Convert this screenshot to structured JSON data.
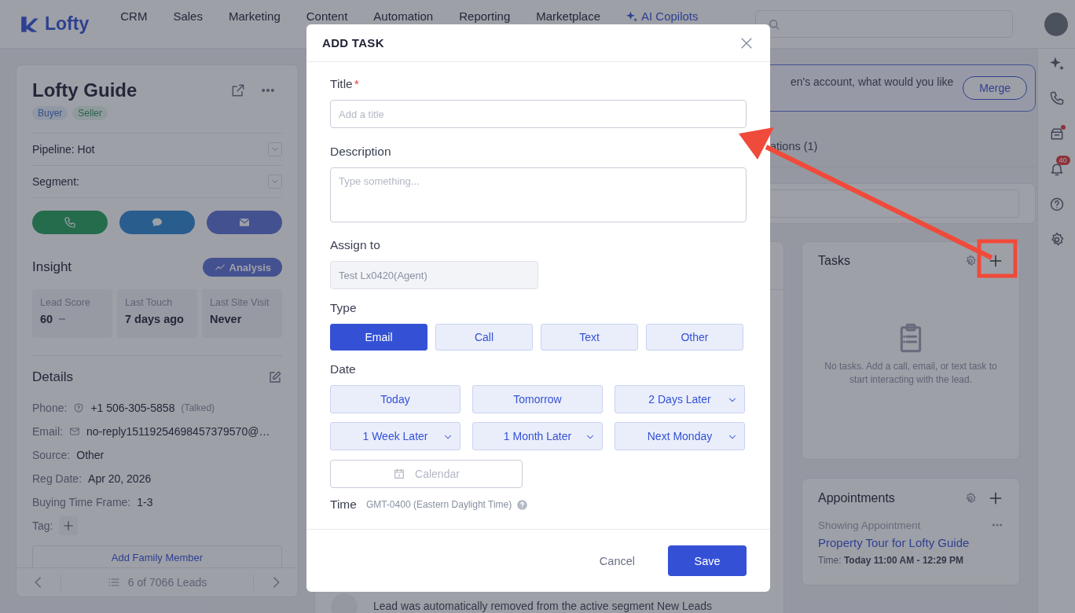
{
  "topbar": {
    "logo": "Lofty",
    "nav": [
      {
        "label": "CRM",
        "kind": "plain"
      },
      {
        "label": "Sales",
        "kind": "plain"
      },
      {
        "label": "Marketing",
        "kind": "plain"
      },
      {
        "label": "Content",
        "kind": "plain"
      },
      {
        "label": "Automation",
        "kind": "plain"
      },
      {
        "label": "Reporting",
        "kind": "plain"
      },
      {
        "label": "Marketplace",
        "kind": "plain"
      },
      {
        "label": "AI Copilots",
        "kind": "ai"
      }
    ]
  },
  "rail": {
    "notifications": "40"
  },
  "lead": {
    "name": "Lofty Guide",
    "tags": [
      {
        "label": "Buyer",
        "kind": "buyer"
      },
      {
        "label": "Seller",
        "kind": "seller"
      }
    ],
    "pipeline": {
      "label": "Pipeline:",
      "value": "Hot"
    },
    "segment": {
      "label": "Segment:"
    },
    "insight": {
      "title": "Insight",
      "button": "Analysis",
      "stats": [
        {
          "label": "Lead Score",
          "value": "60",
          "kind": "score"
        },
        {
          "label": "Last Touch",
          "value": "7 days ago",
          "kind": "plain"
        },
        {
          "label": "Last Site Visit",
          "value": "Never",
          "kind": "plain"
        }
      ]
    },
    "details": {
      "title": "Details",
      "fields": [
        {
          "label": "Phone:",
          "value": "+1 506-305-5858",
          "note": "(Talked)",
          "kind": "phone"
        },
        {
          "label": "Email:",
          "value": "no-reply15119254698457379570@…",
          "kind": "email"
        },
        {
          "label": "Source:",
          "value": "Other",
          "kind": "plain"
        },
        {
          "label": "Reg Date:",
          "value": "Apr 20, 2026",
          "kind": "plain"
        },
        {
          "label": "Buying Time Frame:",
          "value": "1-3",
          "kind": "plain"
        }
      ],
      "tag_label": "Tag:",
      "family_button": "Add Family Member"
    },
    "pager": "6 of 7066 Leads"
  },
  "main": {
    "banner": {
      "text": "en's account, what would you like",
      "button": "Merge"
    },
    "tabs": [
      {
        "label": "ations (1)",
        "selected": false
      }
    ],
    "tasks": {
      "title": "Tasks",
      "empty": "No tasks. Add a call, email, or text task to start interacting with the lead."
    },
    "appointments": {
      "title": "Appointments",
      "items": [
        {
          "type": "Showing Appointment",
          "title": "Property Tour for Lofty Guide",
          "time_label": "Time:",
          "time": "Today 11:00 AM - 12:29 PM"
        }
      ]
    },
    "activity": "Lead was automatically removed from the active segment New Leads"
  },
  "modal": {
    "title": "ADD TASK",
    "task_title": {
      "label": "Title",
      "required_mark": "*",
      "placeholder": "Add a title"
    },
    "description": {
      "label": "Description",
      "placeholder": "Type something..."
    },
    "assign": {
      "label": "Assign to",
      "value": "Test Lx0420(Agent)",
      "disabled": true
    },
    "type": {
      "label": "Type",
      "options": [
        {
          "label": "Email",
          "selected": true
        },
        {
          "label": "Call",
          "selected": false
        },
        {
          "label": "Text",
          "selected": false
        },
        {
          "label": "Other",
          "selected": false
        }
      ]
    },
    "date": {
      "label": "Date",
      "options": [
        {
          "label": "Today",
          "dropdown": false
        },
        {
          "label": "Tomorrow",
          "dropdown": false
        },
        {
          "label": "2 Days Later",
          "dropdown": true
        },
        {
          "label": "1 Week Later",
          "dropdown": true
        },
        {
          "label": "1 Month Later",
          "dropdown": true
        },
        {
          "label": "Next Monday",
          "dropdown": true
        }
      ],
      "calendar_placeholder": "Calendar"
    },
    "time": {
      "label": "Time",
      "timezone": "GMT-0400 (Eastern Daylight Time)"
    },
    "buttons": {
      "cancel": "Cancel",
      "save": "Save"
    }
  }
}
